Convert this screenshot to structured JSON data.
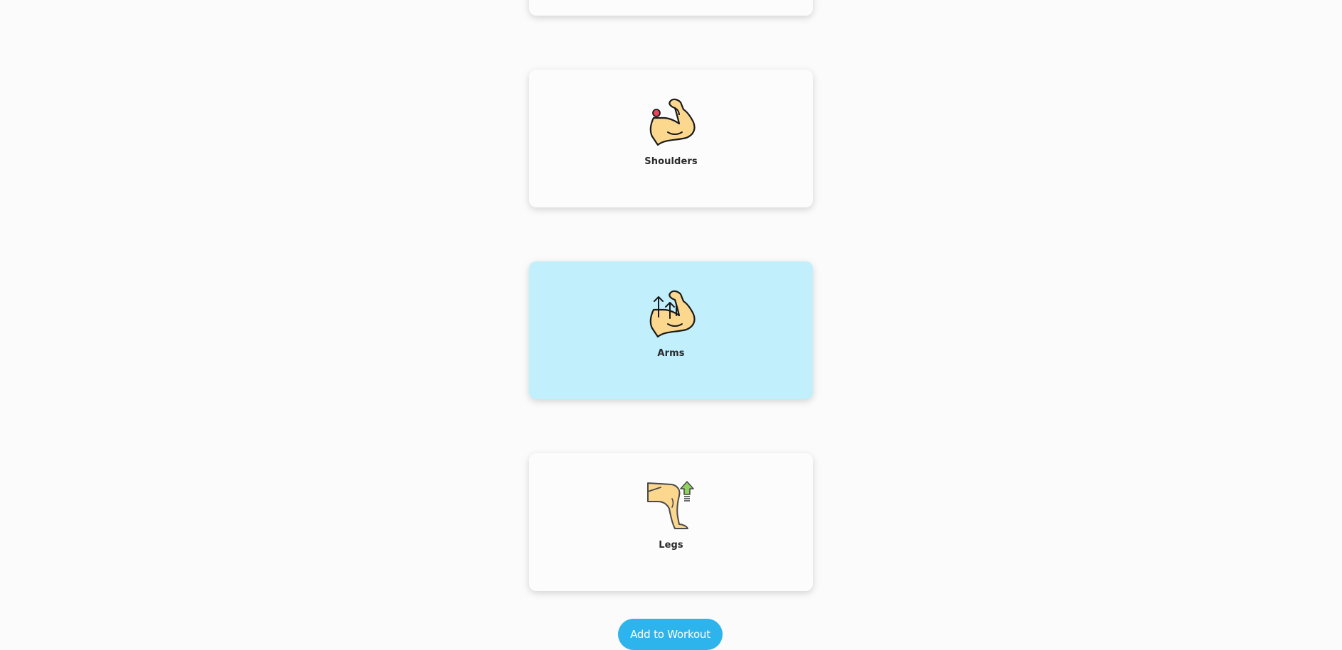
{
  "categories": [
    {
      "label": "",
      "icon": "card-partial",
      "selected": false
    },
    {
      "label": "Shoulders",
      "icon": "flexed-arm-shoulder-icon",
      "selected": false
    },
    {
      "label": "Arms",
      "icon": "flexed-arm-arrows-icon",
      "selected": true
    },
    {
      "label": "Legs",
      "icon": "leg-arrow-up-icon",
      "selected": false
    }
  ],
  "actions": {
    "add_label": "Add to Workout"
  },
  "colors": {
    "background": "#fbfbfb",
    "card": "#fcfcfc",
    "selected_card": "#c1effc",
    "button": "#2eb4ec",
    "skin": "#fcd88f",
    "accent_red": "#e8445a",
    "accent_green": "#8fd35c"
  }
}
